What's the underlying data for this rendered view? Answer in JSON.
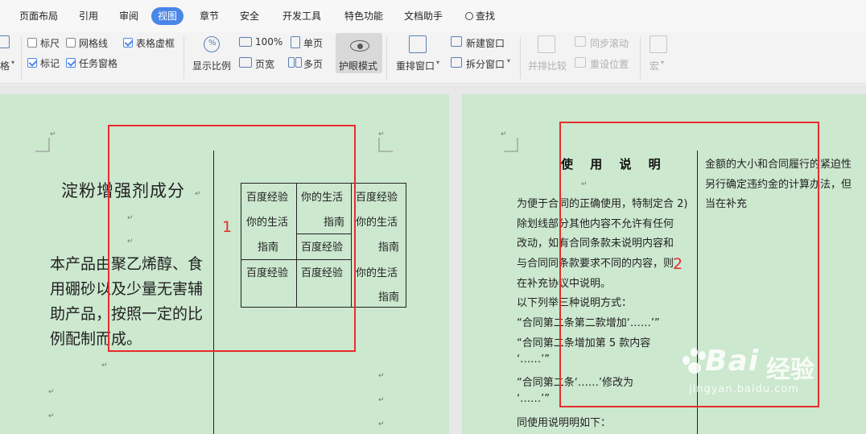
{
  "tabs": [
    {
      "label": "页面布局",
      "active": false
    },
    {
      "label": "引用",
      "active": false
    },
    {
      "label": "审阅",
      "active": false
    },
    {
      "label": "视图",
      "active": true
    },
    {
      "label": "章节",
      "active": false
    },
    {
      "label": "安全",
      "active": false
    },
    {
      "label": "开发工具",
      "active": false
    },
    {
      "label": "特色功能",
      "active": false
    },
    {
      "label": "文档助手",
      "active": false
    },
    {
      "label": "查找",
      "active": false
    }
  ],
  "ribbon": {
    "partial_label": "格",
    "ruler": "标尺",
    "gridlines": "网格线",
    "table_gridlines": "表格虚框",
    "marks": "标记",
    "task_pane": "任务窗格",
    "zoom": "显示比例",
    "zoom_100": "100%",
    "single_page": "单页",
    "page_width": "页宽",
    "multi_page": "多页",
    "eye_mode": "护眼模式",
    "rearrange_window": "重排窗口",
    "new_window": "新建窗口",
    "split_window": "拆分窗口",
    "side_by_side": "并排比较",
    "sync_scroll": "同步滚动",
    "reset_position": "重设位置",
    "macro": "宏"
  },
  "checkbox_state": {
    "ruler": false,
    "gridlines": false,
    "table_gridlines": true,
    "marks": true,
    "task_pane": true
  },
  "left_page": {
    "title": "淀粉增强剂成分",
    "paragraph": "本产品由聚乙烯醇、食用硼砂以及少量无害辅助产品，按照一定的比例配制而成。",
    "table": {
      "col1": [
        "百度经验",
        "你的生活",
        "指南",
        "百度经验"
      ],
      "col2": [
        "你的生活",
        "指南",
        "百度经验",
        "百度经验"
      ],
      "col3": [
        "百度经验",
        "你的生活",
        "指南",
        "你的生活",
        "指南"
      ]
    },
    "annotation": "1"
  },
  "right_page": {
    "title": "使 用 说 明",
    "lines": [
      "为便于合同的正确使用，特制定合",
      "除划线部分其他内容不允许有任何",
      "改动，如有合同条款未说明内容和",
      "与合同同条款要求不同的内容，则",
      "在补充协议中说明。",
      "以下列举三种说明方式：",
      "“合同第二条第二款增加‘……’”",
      "“合同第二条增加第 5 款内容",
      "‘……’”",
      "“合同第二条‘……’修改为",
      "‘……’”",
      "同使用说明明如下："
    ],
    "line1_suffix": "2)",
    "col2_lines": [
      "金额的大小和合同履行的紧迫性",
      "另行确定违约金的计算办法，但",
      "当在补充"
    ],
    "annotation": "2"
  },
  "watermark": {
    "brand": "Bai",
    "brand_cn": "经验",
    "url": "jingyan.baidu.com"
  },
  "colors": {
    "accent": "#4a86e8",
    "page_bg": "#cce8cf",
    "annotation": "#e62d2d"
  }
}
